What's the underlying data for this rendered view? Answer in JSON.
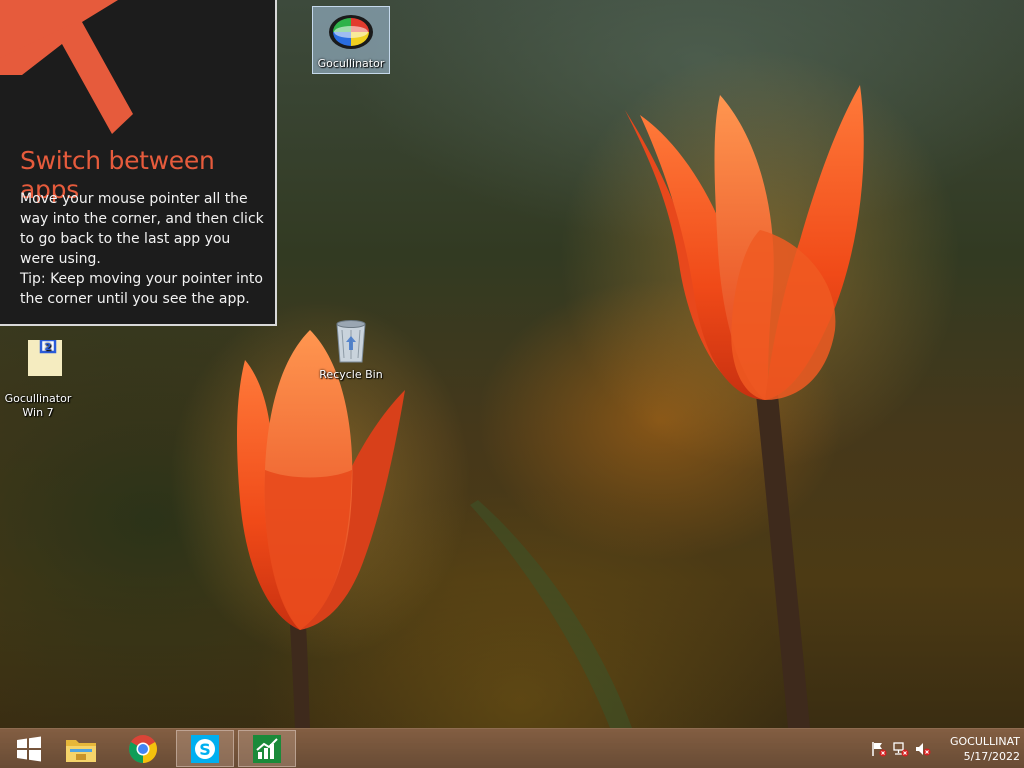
{
  "desktop": {
    "icons": [
      {
        "label": "Gocullinator"
      },
      {
        "label": "Recycle Bin"
      },
      {
        "label": "Gocullinator\nWin 7"
      }
    ]
  },
  "tip": {
    "title": "Switch between apps",
    "body": "Move your mouse pointer all the way into the corner, and then click to go back to the last app you were using.",
    "tip": "Tip: Keep moving your pointer into the corner until you see the app.",
    "accent_color": "#e65b3c"
  },
  "taskbar": {
    "apps": [
      {
        "icon": "start-icon"
      },
      {
        "icon": "file-explorer-icon"
      },
      {
        "icon": "chrome-icon"
      },
      {
        "icon": "skype-icon"
      },
      {
        "icon": "chart-app-icon"
      }
    ],
    "tray": {
      "icons": [
        "action-center-flag-icon",
        "network-icon",
        "volume-muted-icon"
      ],
      "clock_name": "GOCULLINAT",
      "clock_date": "5/17/2022"
    }
  }
}
